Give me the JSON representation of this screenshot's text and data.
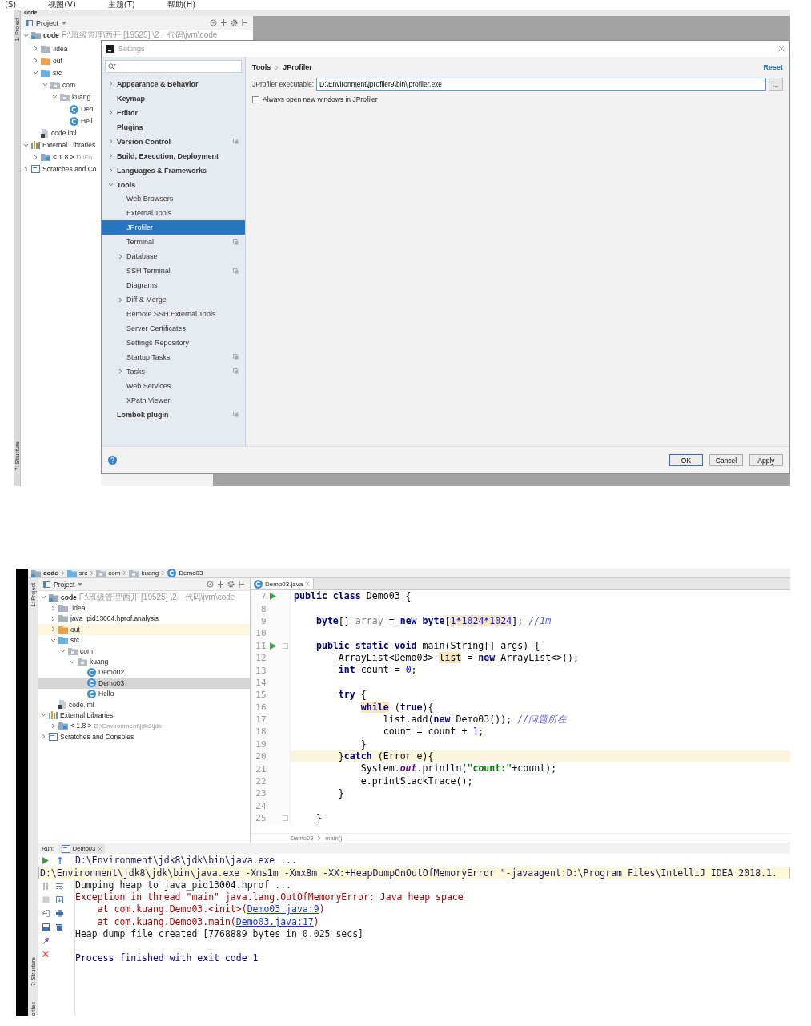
{
  "top_menu": [
    "(S)",
    "视图(V)",
    "主题(T)",
    "帮助(H)"
  ],
  "shot1": {
    "navbar": "code",
    "tool_strip": [
      "1: Project",
      "7: Structure"
    ],
    "project": {
      "title": "Project",
      "tree": [
        {
          "label": "code",
          "path": "F:\\班级管理\\西开 [19525] \\2、代码\\jvm\\code",
          "kind": "module",
          "expanded": true,
          "selected": false,
          "children": [
            {
              "label": ".idea",
              "kind": "folder",
              "expanded": false,
              "selected": false
            },
            {
              "label": "out",
              "kind": "excluded",
              "expanded": false,
              "selected": false
            },
            {
              "label": "src",
              "kind": "source",
              "expanded": true,
              "selected": false,
              "children": [
                {
                  "label": "com",
                  "kind": "package",
                  "expanded": true,
                  "selected": false,
                  "children": [
                    {
                      "label": "kuang",
                      "kind": "package",
                      "expanded": true,
                      "selected": false,
                      "children": [
                        {
                          "label": "Den",
                          "kind": "class",
                          "selected": false
                        },
                        {
                          "label": "Hell",
                          "kind": "class",
                          "selected": false
                        }
                      ]
                    }
                  ]
                }
              ]
            },
            {
              "label": "code.iml",
              "kind": "module_file",
              "selected": false
            }
          ]
        },
        {
          "label": "External Libraries",
          "kind": "libraries",
          "expanded": true,
          "selected": false,
          "children": [
            {
              "label": "< 1.8 >",
              "path": "D:\\En",
              "kind": "sdk",
              "expanded": false,
              "selected": false
            }
          ]
        },
        {
          "label": "Scratches and Co",
          "kind": "scratches",
          "expanded": false,
          "selected": false
        }
      ]
    },
    "settings": {
      "title": "Settings",
      "nav": [
        {
          "label": "Appearance & Behavior",
          "expanded": false,
          "selected": false,
          "project_level": false
        },
        {
          "label": "Keymap",
          "selected": false,
          "project_level": false
        },
        {
          "label": "Editor",
          "expanded": false,
          "selected": false,
          "project_level": false
        },
        {
          "label": "Plugins",
          "selected": false,
          "project_level": false
        },
        {
          "label": "Version Control",
          "expanded": false,
          "selected": false,
          "project_level": true
        },
        {
          "label": "Build, Execution, Deployment",
          "expanded": false,
          "selected": false,
          "project_level": false
        },
        {
          "label": "Languages & Frameworks",
          "expanded": false,
          "selected": false,
          "project_level": false
        },
        {
          "label": "Tools",
          "expanded": true,
          "selected": false,
          "project_level": false,
          "children": [
            {
              "label": "Web Browsers",
              "selected": false,
              "project_level": false
            },
            {
              "label": "External Tools",
              "selected": false,
              "project_level": false
            },
            {
              "label": "JProfiler",
              "selected": true,
              "project_level": false
            },
            {
              "label": "Terminal",
              "selected": false,
              "project_level": true
            },
            {
              "label": "Database",
              "expanded": false,
              "selected": false,
              "project_level": false
            },
            {
              "label": "SSH Terminal",
              "selected": false,
              "project_level": true
            },
            {
              "label": "Diagrams",
              "selected": false,
              "project_level": false
            },
            {
              "label": "Diff & Merge",
              "expanded": false,
              "selected": false,
              "project_level": false
            },
            {
              "label": "Remote SSH External Tools",
              "selected": false,
              "project_level": false
            },
            {
              "label": "Server Certificates",
              "selected": false,
              "project_level": false
            },
            {
              "label": "Settings Repository",
              "selected": false,
              "project_level": false
            },
            {
              "label": "Startup Tasks",
              "selected": false,
              "project_level": true
            },
            {
              "label": "Tasks",
              "expanded": false,
              "selected": false,
              "project_level": true
            },
            {
              "label": "Web Services",
              "selected": false,
              "project_level": false
            },
            {
              "label": "XPath Viewer",
              "selected": false,
              "project_level": false
            }
          ]
        },
        {
          "label": "Lombok plugin",
          "selected": false,
          "project_level": true
        }
      ],
      "breadcrumb": [
        "Tools",
        "JProfiler"
      ],
      "reset": "Reset",
      "executable_label": "JProfiler executable:",
      "executable_value": "D:\\Environment\\jprofiler9\\bin\\jprofiler.exe",
      "browse": "...",
      "checkbox": {
        "label": "Always open new windows in JProfiler",
        "checked": false
      },
      "buttons": [
        {
          "label": "OK",
          "default": true
        },
        {
          "label": "Cancel",
          "default": false
        },
        {
          "label": "Apply",
          "default": false
        }
      ]
    }
  },
  "shot2": {
    "navbar": [
      {
        "label": "code",
        "kind": "module"
      },
      {
        "label": "src",
        "kind": "source"
      },
      {
        "label": "com",
        "kind": "package"
      },
      {
        "label": "kuang",
        "kind": "package"
      },
      {
        "label": "Demo03",
        "kind": "class"
      }
    ],
    "tool_strip": [
      "1: Project",
      "7: Structure",
      "orites"
    ],
    "project": {
      "title": "Project",
      "tree": [
        {
          "label": "code",
          "path": "F:\\班级管理\\西开 [19525] \\2、代码\\jvm\\code",
          "kind": "module",
          "expanded": true,
          "selected": false,
          "highlighted": false,
          "children": [
            {
              "label": ".idea",
              "kind": "folder",
              "expanded": false,
              "selected": false,
              "highlighted": false
            },
            {
              "label": "java_pid13004.hprof.analysis",
              "kind": "folder",
              "expanded": false,
              "selected": false,
              "highlighted": false
            },
            {
              "label": "out",
              "kind": "excluded",
              "expanded": false,
              "selected": false,
              "highlighted": true
            },
            {
              "label": "src",
              "kind": "source",
              "expanded": true,
              "selected": false,
              "highlighted": false,
              "children": [
                {
                  "label": "com",
                  "kind": "package",
                  "expanded": true,
                  "selected": false,
                  "highlighted": false,
                  "children": [
                    {
                      "label": "kuang",
                      "kind": "package",
                      "expanded": true,
                      "selected": false,
                      "highlighted": false,
                      "children": [
                        {
                          "label": "Demo02",
                          "kind": "class",
                          "selected": false,
                          "highlighted": false
                        },
                        {
                          "label": "Demo03",
                          "kind": "class",
                          "selected": true,
                          "highlighted": false
                        },
                        {
                          "label": "Hello",
                          "kind": "class",
                          "selected": false,
                          "highlighted": false
                        }
                      ]
                    }
                  ]
                }
              ]
            },
            {
              "label": "code.iml",
              "kind": "module_file",
              "selected": false,
              "highlighted": false
            }
          ]
        },
        {
          "label": "External Libraries",
          "kind": "libraries",
          "expanded": true,
          "selected": false,
          "highlighted": false,
          "children": [
            {
              "label": "< 1.8 >",
              "path": "D:\\Environment\\jdk8\\jdk",
              "kind": "sdk",
              "expanded": false,
              "selected": false,
              "highlighted": false
            }
          ]
        },
        {
          "label": "Scratches and Consoles",
          "kind": "scratches",
          "expanded": false,
          "selected": false,
          "highlighted": false
        }
      ]
    },
    "editor": {
      "tab": "Demo03.java",
      "lines": [
        {
          "number": "7",
          "run_marker": true,
          "fold_marker": false,
          "current": false,
          "tokens": [
            {
              "text": "public class",
              "kind": "kw"
            },
            {
              "text": " Demo03 {",
              "kind": "plain"
            }
          ]
        },
        {
          "number": "8",
          "run_marker": false,
          "fold_marker": false,
          "current": false
        },
        {
          "number": "9",
          "run_marker": false,
          "fold_marker": false,
          "current": false,
          "tokens": [
            {
              "text": "    byte",
              "kind": "kw"
            },
            {
              "text": "[] ",
              "kind": "plain"
            },
            {
              "text": "array",
              "kind": "unused"
            },
            {
              "text": " = ",
              "kind": "plain"
            },
            {
              "text": "new byte",
              "kind": "kw"
            },
            {
              "text": "[",
              "kind": "plain"
            },
            {
              "text": "1*1024*1024",
              "kind": "num_hl"
            },
            {
              "text": "]; ",
              "kind": "plain"
            },
            {
              "text": "//1m",
              "kind": "comment"
            }
          ]
        },
        {
          "number": "10",
          "run_marker": false,
          "fold_marker": false,
          "current": false
        },
        {
          "number": "11",
          "run_marker": true,
          "fold_marker": true,
          "current": false,
          "tokens": [
            {
              "text": "    public static void",
              "kind": "kw"
            },
            {
              "text": " main(String[] args) {",
              "kind": "plain"
            }
          ]
        },
        {
          "number": "12",
          "run_marker": false,
          "fold_marker": false,
          "current": false,
          "tokens": [
            {
              "text": "        ArrayList<Demo03> ",
              "kind": "plain"
            },
            {
              "text": "list",
              "kind": "hl"
            },
            {
              "text": " = ",
              "kind": "plain"
            },
            {
              "text": "new",
              "kind": "kw"
            },
            {
              "text": " ArrayList<>();",
              "kind": "plain"
            }
          ]
        },
        {
          "number": "13",
          "run_marker": false,
          "fold_marker": false,
          "current": false,
          "tokens": [
            {
              "text": "        int",
              "kind": "kw"
            },
            {
              "text": " count = ",
              "kind": "plain"
            },
            {
              "text": "0",
              "kind": "num"
            },
            {
              "text": ";",
              "kind": "plain"
            }
          ]
        },
        {
          "number": "14",
          "run_marker": false,
          "fold_marker": false,
          "current": false
        },
        {
          "number": "15",
          "run_marker": false,
          "fold_marker": false,
          "current": false,
          "tokens": [
            {
              "text": "        try",
              "kind": "kw"
            },
            {
              "text": " {",
              "kind": "plain"
            }
          ]
        },
        {
          "number": "16",
          "run_marker": false,
          "fold_marker": false,
          "current": false,
          "tokens": [
            {
              "text": "            while",
              "kind": "kw_hl"
            },
            {
              "text": " (",
              "kind": "plain"
            },
            {
              "text": "true",
              "kind": "kw"
            },
            {
              "text": "){",
              "kind": "plain"
            }
          ]
        },
        {
          "number": "17",
          "run_marker": false,
          "fold_marker": false,
          "current": false,
          "tokens": [
            {
              "text": "                list.add(",
              "kind": "plain"
            },
            {
              "text": "new",
              "kind": "kw"
            },
            {
              "text": " Demo03()); ",
              "kind": "plain"
            },
            {
              "text": "//问题所在",
              "kind": "comment"
            }
          ]
        },
        {
          "number": "18",
          "run_marker": false,
          "fold_marker": false,
          "current": false,
          "tokens": [
            {
              "text": "                count = count + ",
              "kind": "plain"
            },
            {
              "text": "1",
              "kind": "num"
            },
            {
              "text": ";",
              "kind": "plain"
            }
          ]
        },
        {
          "number": "19",
          "run_marker": false,
          "fold_marker": false,
          "current": false,
          "tokens": [
            {
              "text": "            }",
              "kind": "plain"
            }
          ]
        },
        {
          "number": "20",
          "run_marker": false,
          "fold_marker": false,
          "current": true,
          "tokens": [
            {
              "text": "        }",
              "kind": "plain"
            },
            {
              "text": "catch",
              "kind": "kw"
            },
            {
              "text": " (Error e){",
              "kind": "plain"
            }
          ]
        },
        {
          "number": "21",
          "run_marker": false,
          "fold_marker": false,
          "current": false,
          "tokens": [
            {
              "text": "            System.",
              "kind": "plain"
            },
            {
              "text": "out",
              "kind": "field"
            },
            {
              "text": ".println(",
              "kind": "plain"
            },
            {
              "text": "\"count:\"",
              "kind": "str"
            },
            {
              "text": "+count);",
              "kind": "plain"
            }
          ]
        },
        {
          "number": "22",
          "run_marker": false,
          "fold_marker": false,
          "current": false,
          "tokens": [
            {
              "text": "            e.printStackTrace();",
              "kind": "plain"
            }
          ]
        },
        {
          "number": "23",
          "run_marker": false,
          "fold_marker": false,
          "current": false,
          "tokens": [
            {
              "text": "        }",
              "kind": "plain"
            }
          ]
        },
        {
          "number": "24",
          "run_marker": false,
          "fold_marker": false,
          "current": false
        },
        {
          "number": "25",
          "run_marker": false,
          "fold_marker": true,
          "current": false,
          "tokens": [
            {
              "text": "    }",
              "kind": "plain"
            }
          ]
        }
      ],
      "breadcrumb": [
        "Demo03",
        "main()"
      ]
    },
    "run": {
      "label": "Run:",
      "tab": "Demo03",
      "command": "D:\\Environment\\jdk8\\jdk\\bin\\java.exe ...",
      "tooltip": "D:\\Environment\\jdk8\\jdk\\bin\\java.exe -Xms1m -Xmx8m -XX:+HeapDumpOnOutOfMemoryError \"-javaagent:D:\\Program Files\\IntelliJ IDEA 2018.1.",
      "output": [
        {
          "kind": "info",
          "text": "Dumping heap to java_pid13004.hprof ..."
        },
        {
          "kind": "error",
          "text": "Exception in thread \"main\" java.lang.OutOfMemoryError: Java heap space"
        },
        {
          "kind": "error",
          "text": "    at com.kuang.Demo03.<init>(",
          "link": "Demo03.java:9",
          "after": ")"
        },
        {
          "kind": "error",
          "text": "    at com.kuang.Demo03.main(",
          "link": "Demo03.java:17",
          "after": ")"
        },
        {
          "kind": "info",
          "text": "Heap dump file created [7768889 bytes in 0.025 secs]"
        },
        {
          "kind": "blank"
        },
        {
          "kind": "system",
          "text": "Process finished with exit code 1"
        }
      ]
    }
  }
}
